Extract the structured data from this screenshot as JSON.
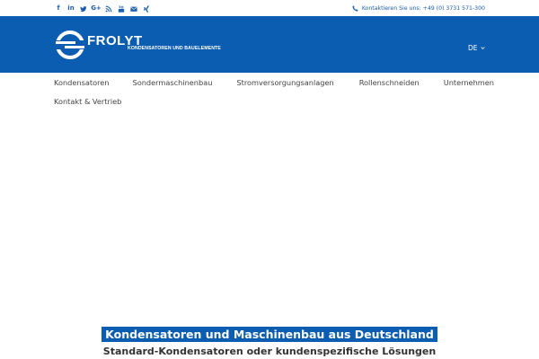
{
  "topbar": {
    "social": [
      {
        "icon": "facebook-icon",
        "glyph": "f"
      },
      {
        "icon": "linkedin-icon",
        "glyph": "in"
      },
      {
        "icon": "twitter-icon",
        "glyph": "t"
      },
      {
        "icon": "google-plus-icon",
        "glyph": "G+"
      },
      {
        "icon": "rss-icon",
        "glyph": ""
      },
      {
        "icon": "youtube-icon",
        "glyph": ""
      },
      {
        "icon": "email-icon",
        "glyph": ""
      },
      {
        "icon": "xing-icon",
        "glyph": "x"
      }
    ],
    "contact_text": "Kontaktieren Sie uns: +49 (0) 3731 571-300",
    "contact_icon": "phone-icon"
  },
  "header": {
    "brand": "FROLYT",
    "tagline": "KONDENSATOREN UND BAUELEMENTE",
    "language": "DE",
    "color": "#0b5db2"
  },
  "nav": {
    "items": [
      "Kondensatoren",
      "Sondermaschinenbau",
      "Stromversorgungsanlagen",
      "Rollenschneiden",
      "Unternehmen",
      "Kontakt & Vertrieb"
    ]
  },
  "hero": {
    "title": "Kondensatoren und Maschinenbau aus Deutschland",
    "subtitle": "Standard-Kondensatoren oder kundenspezifische Lösungen"
  }
}
